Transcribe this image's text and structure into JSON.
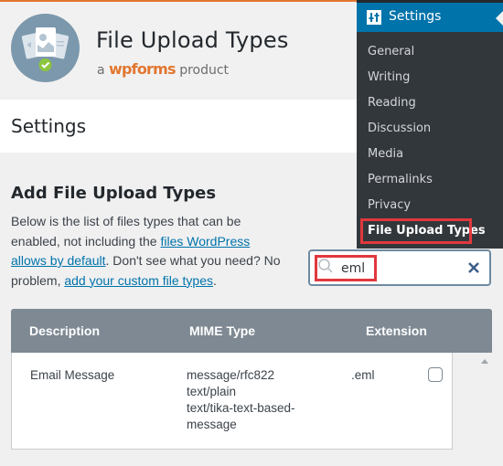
{
  "header": {
    "title": "File Upload Types",
    "tagline_prefix": "a",
    "brand": "wpforms",
    "tagline_suffix": "product",
    "logo_icon": "file-types-logo-icon"
  },
  "page": {
    "title": "Settings"
  },
  "section": {
    "title": "Add File Upload Types",
    "desc_part1": "Below is the list of files types that can be enabled, not including the ",
    "link1": "files WordPress allows by default",
    "desc_part2": ". Don't see what you need? No problem, ",
    "link2": "add your custom file types",
    "desc_part3": "."
  },
  "search": {
    "value": "eml",
    "placeholder": "",
    "search_icon": "search-icon",
    "clear_icon": "close-icon"
  },
  "sidebar": {
    "head_label": "Settings",
    "head_icon": "settings-sliders-icon",
    "items": [
      {
        "label": "General"
      },
      {
        "label": "Writing"
      },
      {
        "label": "Reading"
      },
      {
        "label": "Discussion"
      },
      {
        "label": "Media"
      },
      {
        "label": "Permalinks"
      },
      {
        "label": "Privacy"
      },
      {
        "label": "File Upload Types",
        "active": true
      }
    ]
  },
  "table": {
    "columns": [
      "Description",
      "MIME Type",
      "Extension"
    ],
    "rows": [
      {
        "description": "Email Message",
        "mime": [
          "message/rfc822",
          "text/plain",
          "text/tika-text-based-",
          "message"
        ],
        "extension": ".eml",
        "checked": false
      }
    ]
  },
  "colors": {
    "accent_orange": "#e27730",
    "admin_blue": "#0073aa",
    "sidebar_bg": "#32373c",
    "table_header_bg": "#7e8993",
    "highlight_red": "#e0383e"
  }
}
